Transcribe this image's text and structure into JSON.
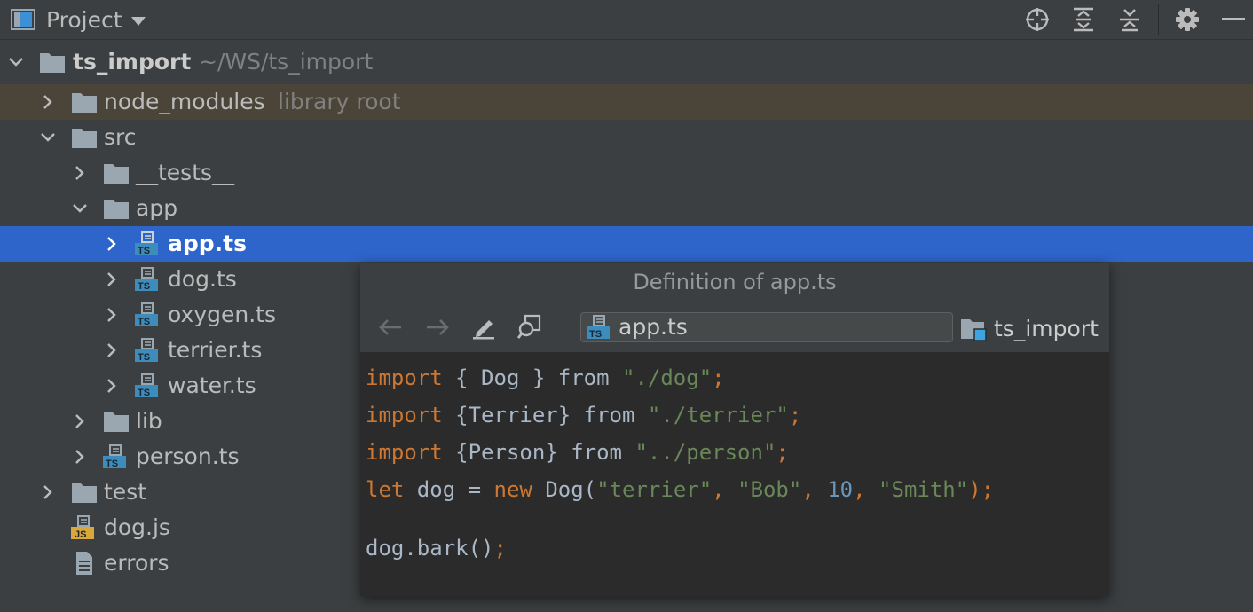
{
  "header": {
    "title": "Project",
    "icons": [
      "locate-icon",
      "expand-all-icon",
      "collapse-all-icon",
      "gear-icon",
      "minimize-icon"
    ]
  },
  "tree": {
    "root": {
      "label": "ts_import",
      "path": "~/WS/ts_import"
    },
    "items": [
      {
        "label": "node_modules",
        "suffix": "library root"
      },
      {
        "label": "src"
      },
      {
        "label": "__tests__"
      },
      {
        "label": "app"
      },
      {
        "label": "app.ts"
      },
      {
        "label": "dog.ts"
      },
      {
        "label": "oxygen.ts"
      },
      {
        "label": "terrier.ts"
      },
      {
        "label": "water.ts"
      },
      {
        "label": "lib"
      },
      {
        "label": "person.ts"
      },
      {
        "label": "test"
      },
      {
        "label": "dog.js"
      },
      {
        "label": "errors"
      }
    ]
  },
  "popup": {
    "title": "Definition of app.ts",
    "file_field": "app.ts",
    "module": "ts_import",
    "code": {
      "l1": {
        "a": "import",
        "b": " { Dog } ",
        "c": "from",
        "d": " ",
        "e": "\"./dog\"",
        "f": ";"
      },
      "l2": {
        "a": "import",
        "b": " {Terrier} ",
        "c": "from",
        "d": " ",
        "e": "\"./terrier\"",
        "f": ";"
      },
      "l3": {
        "a": "import",
        "b": " {Person} ",
        "c": "from",
        "d": " ",
        "e": "\"../person\"",
        "f": ";"
      },
      "l4": {
        "a": "let",
        "b": " dog = ",
        "c": "new",
        "d": " Dog(",
        "e": "\"terrier\"",
        "f": ", ",
        "g": "\"Bob\"",
        "h": ", ",
        "i": "10",
        "j": ", ",
        "k": "\"Smith\"",
        "l": ");"
      },
      "l5": {
        "a": "dog.bark()",
        "b": ";"
      }
    }
  },
  "colors": {
    "selection": "#2e65ca",
    "library_root_row": "#4a4538",
    "keyword": "#cc7832",
    "string": "#6a8759",
    "number": "#6897bb"
  }
}
